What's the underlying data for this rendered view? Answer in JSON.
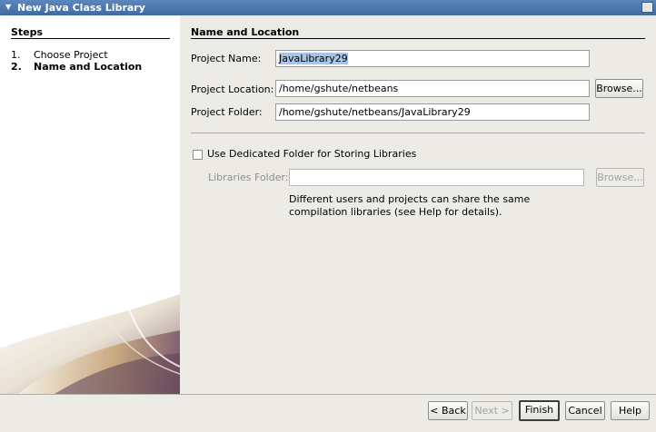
{
  "window": {
    "title": "New Java Class Library"
  },
  "steps": {
    "title": "Steps",
    "items": [
      {
        "num": "1.",
        "label": "Choose Project"
      },
      {
        "num": "2.",
        "label": "Name and Location"
      }
    ]
  },
  "panel": {
    "title": "Name and Location",
    "project_name_label": "Project Name:",
    "project_name_value": "JavaLibrary29",
    "project_location_label": "Project Location:",
    "project_location_value": "/home/gshute/netbeans",
    "browse_label": "Browse...",
    "project_folder_label": "Project Folder:",
    "project_folder_value": "/home/gshute/netbeans/JavaLibrary29",
    "dedicated_folder_label": "Use Dedicated Folder for Storing Libraries",
    "dedicated_folder_checked": false,
    "libraries_folder_label": "Libraries Folder:",
    "libraries_folder_value": "",
    "libraries_browse_label": "Browse...",
    "help_text": "Different users and projects can share the same compilation libraries (see Help for details)."
  },
  "buttons": {
    "back": "< Back",
    "next": "Next >",
    "finish": "Finish",
    "cancel": "Cancel",
    "help": "Help"
  }
}
